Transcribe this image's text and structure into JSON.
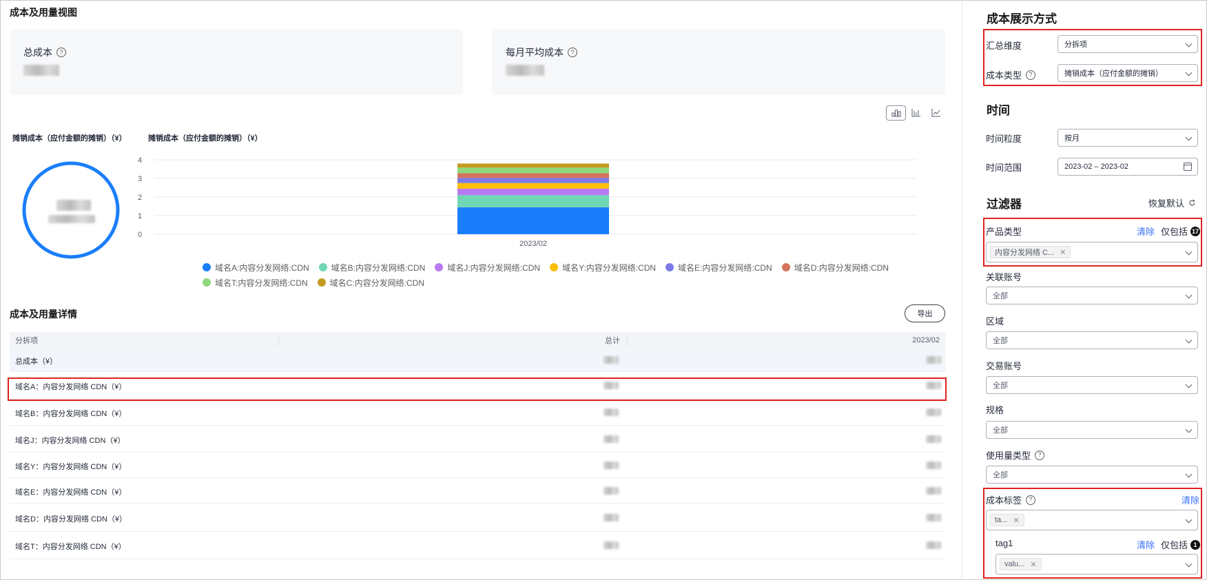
{
  "overview": {
    "title": "成本及用量视图",
    "total_cost_label": "总成本",
    "monthly_avg_label": "每月平均成本"
  },
  "charts": {
    "donut_title": "摊销成本（应付金额的摊销）（¥）",
    "bar_title": "摊销成本（应付金额的摊销）（¥）",
    "view_switch": [
      "bar-chart-icon",
      "column-chart-icon",
      "line-chart-icon"
    ]
  },
  "chart_data": {
    "type": "bar",
    "stacked": true,
    "categories": [
      "2023/02"
    ],
    "yticks": [
      0,
      1,
      2,
      3,
      4
    ],
    "ylim": [
      0,
      4
    ],
    "grid": true,
    "legend_position": "bottom",
    "series": [
      {
        "name": "域名A:内容分发网络:CDN",
        "color": "#1a7efb",
        "values": [
          1.45
        ]
      },
      {
        "name": "域名B:内容分发网络:CDN",
        "color": "#6fd7b3",
        "values": [
          0.65
        ]
      },
      {
        "name": "域名J:内容分发网络:CDN",
        "color": "#b77af0",
        "values": [
          0.35
        ]
      },
      {
        "name": "域名Y:内容分发网络:CDN",
        "color": "#fbbf00",
        "values": [
          0.3
        ]
      },
      {
        "name": "域名E:内容分发网络:CDN",
        "color": "#7c7ae8",
        "values": [
          0.28
        ]
      },
      {
        "name": "域名D:内容分发网络:CDN",
        "color": "#d4735e",
        "values": [
          0.25
        ]
      },
      {
        "name": "域名T:内容分发网络:CDN",
        "color": "#8ed77a",
        "values": [
          0.3
        ]
      },
      {
        "name": "域名C:内容分发网络:CDN",
        "color": "#c49a22",
        "values": [
          0.22
        ]
      }
    ]
  },
  "details": {
    "title": "成本及用量详情",
    "export_label": "导出",
    "columns": [
      "分拆项",
      "总计",
      "2023/02"
    ],
    "rows": [
      "总成本（¥）",
      "域名A：内容分发网络 CDN（¥）",
      "域名B：内容分发网络 CDN（¥）",
      "域名J：内容分发网络 CDN（¥）",
      "域名Y：内容分发网络 CDN（¥）",
      "域名E：内容分发网络 CDN（¥）",
      "域名D：内容分发网络 CDN（¥）",
      "域名T：内容分发网络 CDN（¥）"
    ]
  },
  "sidebar": {
    "display_title": "成本展示方式",
    "group_label": "汇总维度",
    "group_value": "分拆项",
    "cost_type_label": "成本类型",
    "cost_type_value": "摊销成本（应付金额的摊销）",
    "time_title": "时间",
    "granularity_label": "时间粒度",
    "granularity_value": "按月",
    "range_label": "时间范围",
    "range_value": "2023-02 – 2023-02",
    "filter_title": "过滤器",
    "reset_label": "恢复默认",
    "product_label": "产品类型",
    "clear_label": "清除",
    "only_include_label": "仅包括",
    "product_count": "17",
    "product_tag": "内容分发网络 C...",
    "linked_account_label": "关联账号",
    "region_label": "区域",
    "trade_account_label": "交易账号",
    "spec_label": "规格",
    "usage_type_label": "使用量类型",
    "all_label": "全部",
    "cost_tag_label": "成本标签",
    "cost_tag_chip": "ta...",
    "tag1_label": "tag1",
    "tag1_count": "1",
    "tag1_chip": "valu..."
  }
}
